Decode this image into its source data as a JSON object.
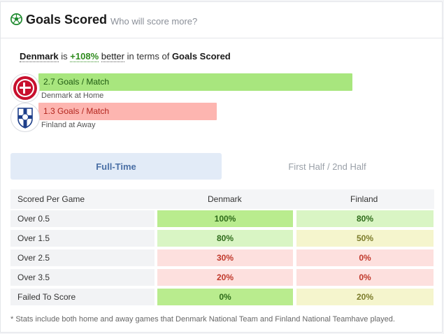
{
  "header": {
    "title": "Goals Scored",
    "subtitle": "Who will score more?"
  },
  "summary": {
    "team": "Denmark",
    "is_word": "is",
    "percent": "+108%",
    "better_word": "better",
    "in_terms_of": "in terms of",
    "metric": "Goals Scored"
  },
  "bars": [
    {
      "label": "2.7 Goals / Match",
      "sub": "Denmark at Home",
      "value": 2.7,
      "crest_icon": "denmark-crest-icon"
    },
    {
      "label": "1.3 Goals / Match",
      "sub": "Finland at Away",
      "value": 1.3,
      "crest_icon": "finland-crest-icon"
    }
  ],
  "tabs": [
    {
      "label": "Full-Time",
      "active": true
    },
    {
      "label": "First Half / 2nd Half",
      "active": false
    }
  ],
  "table": {
    "headers": [
      "Scored Per Game",
      "Denmark",
      "Finland"
    ],
    "rows": [
      {
        "label": "Over 0.5",
        "denmark": "100%",
        "finland": "80%"
      },
      {
        "label": "Over 1.5",
        "denmark": "80%",
        "finland": "50%"
      },
      {
        "label": "Over 2.5",
        "denmark": "30%",
        "finland": "0%"
      },
      {
        "label": "Over 3.5",
        "denmark": "20%",
        "finland": "0%"
      },
      {
        "label": "Failed To Score",
        "denmark": "0%",
        "finland": "20%"
      }
    ]
  },
  "colors": {
    "strong_green": "#b9ec8e",
    "light_green": "#d9f5c4",
    "yellow": "#f5f5cd",
    "red": "#fde0de",
    "green_text": "#2e6b1a",
    "yellow_text": "#7b7b2a",
    "red_text": "#c0392b"
  },
  "footnote": "* Stats include both home and away games that Denmark National Team and Finland National Teamhave played."
}
